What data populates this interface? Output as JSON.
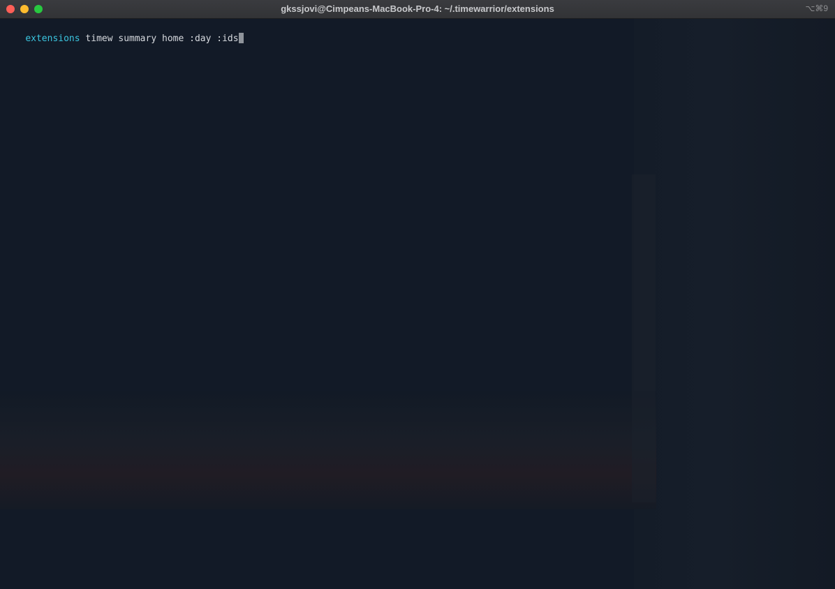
{
  "window": {
    "title": "gkssjovi@Cimpeans-MacBook-Pro-4: ~/.timewarrior/extensions",
    "shortcut": "⌥⌘9"
  },
  "terminal": {
    "prompt_dir": "extensions",
    "command": " timew summary home :day :ids"
  },
  "colors": {
    "background": "#121a27",
    "prompt_dir": "#3bc6e0",
    "command_text": "#d6d9de",
    "close": "#ff5f57",
    "minimize": "#febc2e",
    "maximize": "#28c840"
  }
}
